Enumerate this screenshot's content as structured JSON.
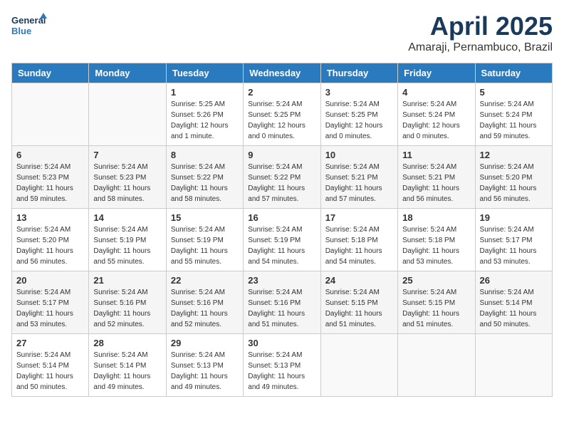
{
  "logo": {
    "line1": "General",
    "line2": "Blue"
  },
  "title": "April 2025",
  "subtitle": "Amaraji, Pernambuco, Brazil",
  "weekdays": [
    "Sunday",
    "Monday",
    "Tuesday",
    "Wednesday",
    "Thursday",
    "Friday",
    "Saturday"
  ],
  "weeks": [
    [
      {
        "day": "",
        "info": ""
      },
      {
        "day": "",
        "info": ""
      },
      {
        "day": "1",
        "info": "Sunrise: 5:25 AM\nSunset: 5:26 PM\nDaylight: 12 hours and 1 minute."
      },
      {
        "day": "2",
        "info": "Sunrise: 5:24 AM\nSunset: 5:25 PM\nDaylight: 12 hours and 0 minutes."
      },
      {
        "day": "3",
        "info": "Sunrise: 5:24 AM\nSunset: 5:25 PM\nDaylight: 12 hours and 0 minutes."
      },
      {
        "day": "4",
        "info": "Sunrise: 5:24 AM\nSunset: 5:24 PM\nDaylight: 12 hours and 0 minutes."
      },
      {
        "day": "5",
        "info": "Sunrise: 5:24 AM\nSunset: 5:24 PM\nDaylight: 11 hours and 59 minutes."
      }
    ],
    [
      {
        "day": "6",
        "info": "Sunrise: 5:24 AM\nSunset: 5:23 PM\nDaylight: 11 hours and 59 minutes."
      },
      {
        "day": "7",
        "info": "Sunrise: 5:24 AM\nSunset: 5:23 PM\nDaylight: 11 hours and 58 minutes."
      },
      {
        "day": "8",
        "info": "Sunrise: 5:24 AM\nSunset: 5:22 PM\nDaylight: 11 hours and 58 minutes."
      },
      {
        "day": "9",
        "info": "Sunrise: 5:24 AM\nSunset: 5:22 PM\nDaylight: 11 hours and 57 minutes."
      },
      {
        "day": "10",
        "info": "Sunrise: 5:24 AM\nSunset: 5:21 PM\nDaylight: 11 hours and 57 minutes."
      },
      {
        "day": "11",
        "info": "Sunrise: 5:24 AM\nSunset: 5:21 PM\nDaylight: 11 hours and 56 minutes."
      },
      {
        "day": "12",
        "info": "Sunrise: 5:24 AM\nSunset: 5:20 PM\nDaylight: 11 hours and 56 minutes."
      }
    ],
    [
      {
        "day": "13",
        "info": "Sunrise: 5:24 AM\nSunset: 5:20 PM\nDaylight: 11 hours and 56 minutes."
      },
      {
        "day": "14",
        "info": "Sunrise: 5:24 AM\nSunset: 5:19 PM\nDaylight: 11 hours and 55 minutes."
      },
      {
        "day": "15",
        "info": "Sunrise: 5:24 AM\nSunset: 5:19 PM\nDaylight: 11 hours and 55 minutes."
      },
      {
        "day": "16",
        "info": "Sunrise: 5:24 AM\nSunset: 5:19 PM\nDaylight: 11 hours and 54 minutes."
      },
      {
        "day": "17",
        "info": "Sunrise: 5:24 AM\nSunset: 5:18 PM\nDaylight: 11 hours and 54 minutes."
      },
      {
        "day": "18",
        "info": "Sunrise: 5:24 AM\nSunset: 5:18 PM\nDaylight: 11 hours and 53 minutes."
      },
      {
        "day": "19",
        "info": "Sunrise: 5:24 AM\nSunset: 5:17 PM\nDaylight: 11 hours and 53 minutes."
      }
    ],
    [
      {
        "day": "20",
        "info": "Sunrise: 5:24 AM\nSunset: 5:17 PM\nDaylight: 11 hours and 53 minutes."
      },
      {
        "day": "21",
        "info": "Sunrise: 5:24 AM\nSunset: 5:16 PM\nDaylight: 11 hours and 52 minutes."
      },
      {
        "day": "22",
        "info": "Sunrise: 5:24 AM\nSunset: 5:16 PM\nDaylight: 11 hours and 52 minutes."
      },
      {
        "day": "23",
        "info": "Sunrise: 5:24 AM\nSunset: 5:16 PM\nDaylight: 11 hours and 51 minutes."
      },
      {
        "day": "24",
        "info": "Sunrise: 5:24 AM\nSunset: 5:15 PM\nDaylight: 11 hours and 51 minutes."
      },
      {
        "day": "25",
        "info": "Sunrise: 5:24 AM\nSunset: 5:15 PM\nDaylight: 11 hours and 51 minutes."
      },
      {
        "day": "26",
        "info": "Sunrise: 5:24 AM\nSunset: 5:14 PM\nDaylight: 11 hours and 50 minutes."
      }
    ],
    [
      {
        "day": "27",
        "info": "Sunrise: 5:24 AM\nSunset: 5:14 PM\nDaylight: 11 hours and 50 minutes."
      },
      {
        "day": "28",
        "info": "Sunrise: 5:24 AM\nSunset: 5:14 PM\nDaylight: 11 hours and 49 minutes."
      },
      {
        "day": "29",
        "info": "Sunrise: 5:24 AM\nSunset: 5:13 PM\nDaylight: 11 hours and 49 minutes."
      },
      {
        "day": "30",
        "info": "Sunrise: 5:24 AM\nSunset: 5:13 PM\nDaylight: 11 hours and 49 minutes."
      },
      {
        "day": "",
        "info": ""
      },
      {
        "day": "",
        "info": ""
      },
      {
        "day": "",
        "info": ""
      }
    ]
  ],
  "colors": {
    "header_bg": "#2a7abf",
    "header_text": "#ffffff",
    "row_even": "#f0f0f0",
    "row_odd": "#ffffff",
    "title_color": "#1a3a5c"
  }
}
